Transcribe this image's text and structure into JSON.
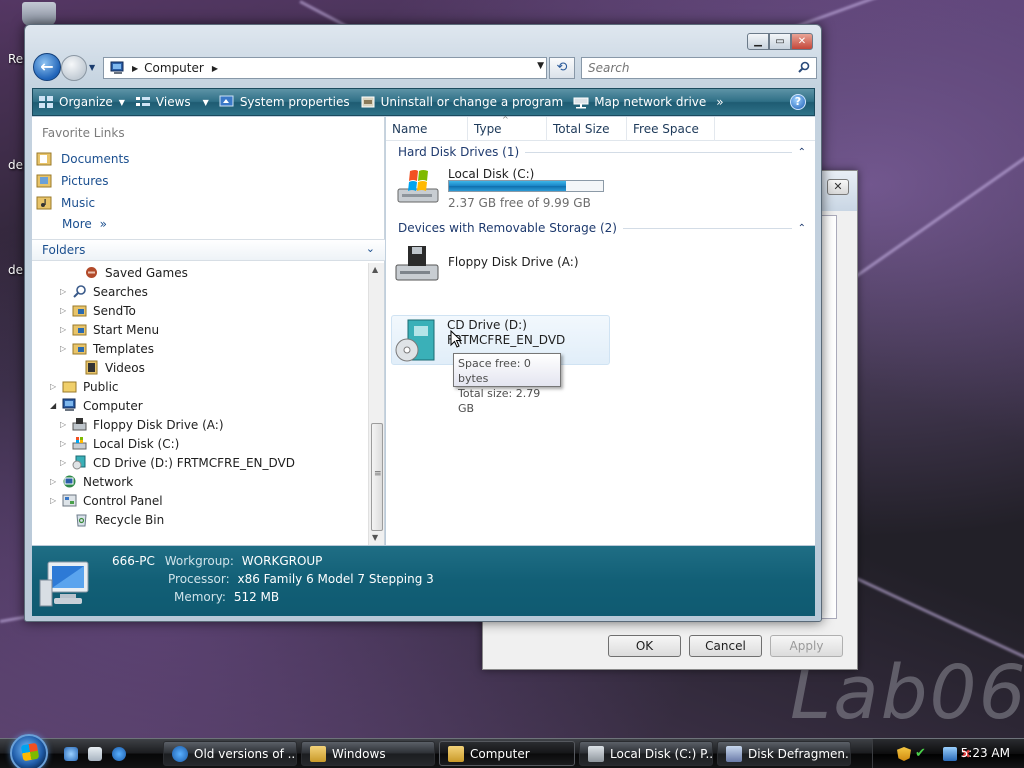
{
  "desktop": {
    "icon_labels": [
      "Re",
      "de",
      "de"
    ],
    "watermark": "Lab06"
  },
  "background_dialog": {
    "ok_label": "OK",
    "cancel_label": "Cancel",
    "apply_label": "Apply",
    "close_glyph": "✕"
  },
  "window": {
    "address": {
      "location": "Computer"
    },
    "search": {
      "placeholder": "Search"
    },
    "toolbar": {
      "organize": "Organize",
      "views": "Views",
      "system_properties": "System properties",
      "uninstall": "Uninstall or change a program",
      "map_drive": "Map network drive",
      "overflow": "»",
      "help": "?"
    },
    "nav": {
      "favorite_links_header": "Favorite Links",
      "favorites": [
        {
          "label": "Documents",
          "icon": "documents-icon"
        },
        {
          "label": "Pictures",
          "icon": "pictures-icon"
        },
        {
          "label": "Music",
          "icon": "music-icon"
        }
      ],
      "more": "More",
      "folders_label": "Folders",
      "tree": [
        {
          "label": "Saved Games",
          "icon": "saved-games-icon",
          "indent": 2,
          "expander": false
        },
        {
          "label": "Searches",
          "icon": "searches-icon",
          "indent": 2,
          "expander": true
        },
        {
          "label": "SendTo",
          "icon": "folder-icon",
          "indent": 2,
          "expander": true
        },
        {
          "label": "Start Menu",
          "icon": "folder-icon",
          "indent": 2,
          "expander": true
        },
        {
          "label": "Templates",
          "icon": "folder-icon",
          "indent": 2,
          "expander": true
        },
        {
          "label": "Videos",
          "icon": "videos-icon",
          "indent": 2,
          "expander": false
        },
        {
          "label": "Public",
          "icon": "folder-icon",
          "indent": 1,
          "expander": true
        },
        {
          "label": "Computer",
          "icon": "computer-icon",
          "indent": 1,
          "expander": "open"
        },
        {
          "label": "Floppy Disk Drive (A:)",
          "icon": "floppy-icon",
          "indent": 2,
          "expander": true
        },
        {
          "label": "Local Disk (C:)",
          "icon": "hard-disk-icon",
          "indent": 2,
          "expander": true
        },
        {
          "label": "CD Drive (D:) FRTMCFRE_EN_DVD",
          "icon": "cd-drive-icon",
          "indent": 2,
          "expander": true
        },
        {
          "label": "Network",
          "icon": "network-icon",
          "indent": 1,
          "expander": true
        },
        {
          "label": "Control Panel",
          "icon": "control-panel-icon",
          "indent": 1,
          "expander": true
        },
        {
          "label": "Recycle Bin",
          "icon": "recycle-bin-icon",
          "indent": 1,
          "expander": false
        }
      ]
    },
    "columns": [
      "Name",
      "Type",
      "Total Size",
      "Free Space"
    ],
    "groups": {
      "hard_disk": "Hard Disk Drives (1)",
      "removable": "Devices with Removable Storage (2)"
    },
    "drives": {
      "local_c": {
        "name": "Local Disk (C:)",
        "free_text": "2.37 GB free of 9.99 GB",
        "used_fraction": 0.76
      },
      "floppy": {
        "name": "Floppy Disk Drive (A:)"
      },
      "cd": {
        "name": "CD Drive (D:)",
        "label": "FRTMCFRE_EN_DVD"
      }
    },
    "tooltip": {
      "line1": "Space free: 0 bytes",
      "line2": "Total size: 2.79 GB"
    },
    "details": {
      "pc_name": "666-PC",
      "workgroup_label": "Workgroup:",
      "workgroup": "WORKGROUP",
      "processor_label": "Processor:",
      "processor": "x86 Family 6 Model 7 Stepping 3",
      "memory_label": "Memory:",
      "memory": "512 MB"
    }
  },
  "taskbar": {
    "buttons": [
      {
        "label": "Old versions of ...",
        "icon": "ie-icon"
      },
      {
        "label": "Windows",
        "icon": "folder-icon"
      },
      {
        "label": "Computer",
        "icon": "folder-icon",
        "active": true
      },
      {
        "label": "Local Disk (C:) P...",
        "icon": "hard-disk-icon"
      },
      {
        "label": "Disk Defragmen...",
        "icon": "defrag-icon"
      }
    ],
    "clock": "5:23 AM"
  },
  "colors": {
    "toolbar": "#2f6f86",
    "details": "#125f76",
    "link": "#1b4f8f",
    "progress": "#1a84c6"
  }
}
